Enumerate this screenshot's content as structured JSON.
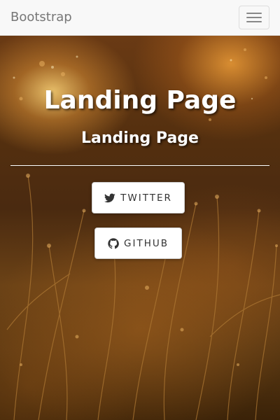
{
  "navbar": {
    "brand": "Bootstrap",
    "toggle_icon": "hamburger-icon"
  },
  "hero": {
    "title": "Landing Page",
    "subtitle": "Landing Page",
    "buttons": [
      {
        "label": "TWITTER",
        "icon": "twitter-icon"
      },
      {
        "label": "GITHUB",
        "icon": "github-icon"
      }
    ]
  },
  "colors": {
    "navbar_bg": "#f8f8f8",
    "brand_text": "#777777",
    "hero_text": "#ffffff",
    "button_bg": "#ffffff",
    "button_text": "#333333"
  }
}
